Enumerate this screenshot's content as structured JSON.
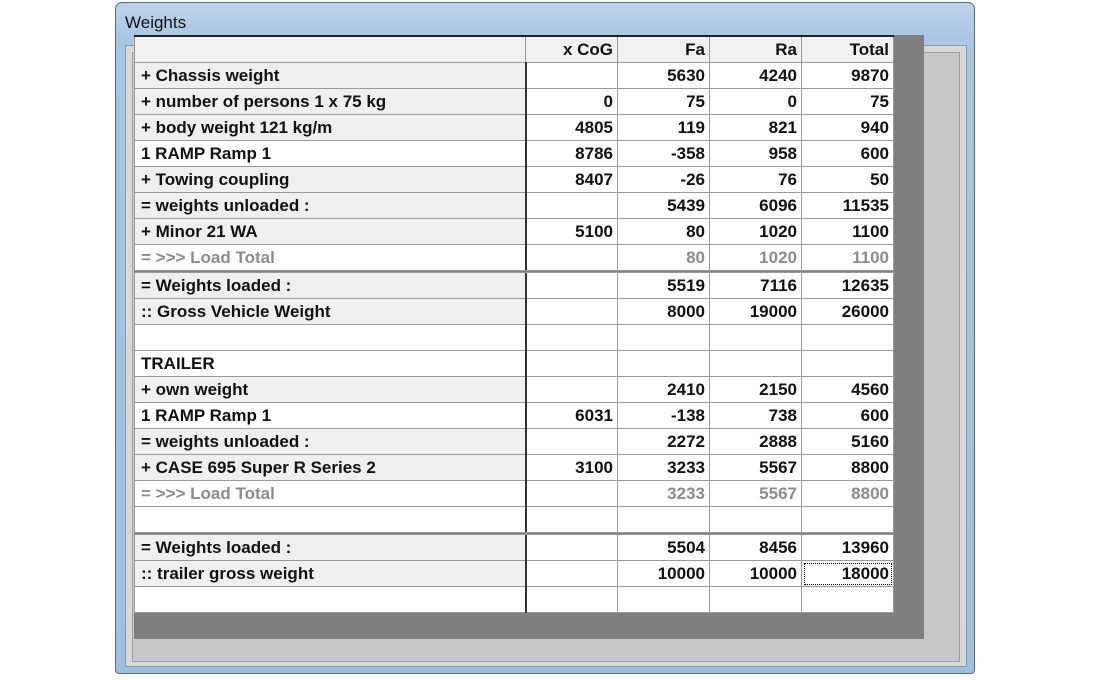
{
  "window": {
    "title": "Weights"
  },
  "columns": [
    "",
    "x CoG",
    "Fa",
    "Ra",
    "Total"
  ],
  "rows": [
    {
      "label": "+ Chassis weight",
      "cog": "",
      "fa": "5630",
      "ra": "4240",
      "total": "9870",
      "style": "shade"
    },
    {
      "label": "+ number of persons  1 x 75 kg",
      "cog": "0",
      "fa": "75",
      "ra": "0",
      "total": "75",
      "style": "shade"
    },
    {
      "label": "+ body weight  121 kg/m",
      "cog": "4805",
      "fa": "119",
      "ra": "821",
      "total": "940",
      "style": "shade"
    },
    {
      "label": "1 RAMP  Ramp 1",
      "cog": "8786",
      "fa": "-358",
      "ra": "958",
      "total": "600",
      "style": "plain"
    },
    {
      "label": "+ Towing coupling",
      "cog": "8407",
      "fa": "-26",
      "ra": "76",
      "total": "50",
      "style": "shade"
    },
    {
      "label": "= weights unloaded  :",
      "cog": "",
      "fa": "5439",
      "ra": "6096",
      "total": "11535",
      "style": "shade"
    },
    {
      "label": "+ Minor 21 WA",
      "cog": "5100",
      "fa": "80",
      "ra": "1020",
      "total": "1100",
      "style": "shade"
    },
    {
      "label": "= >>> Load Total",
      "cog": "",
      "fa": "80",
      "ra": "1020",
      "total": "1100",
      "style": "grey"
    },
    {
      "label": "= Weights loaded    :",
      "cog": "",
      "fa": "5519",
      "ra": "7116",
      "total": "12635",
      "style": "dbl"
    },
    {
      "label": ":: Gross Vehicle Weight",
      "cog": "",
      "fa": "8000",
      "ra": "19000",
      "total": "26000",
      "style": "shade"
    },
    {
      "label": "",
      "cog": "",
      "fa": "",
      "ra": "",
      "total": "",
      "style": "plain"
    },
    {
      "label": "TRAILER",
      "cog": "",
      "fa": "",
      "ra": "",
      "total": "",
      "style": "plain"
    },
    {
      "label": "+ own weight",
      "cog": "",
      "fa": "2410",
      "ra": "2150",
      "total": "4560",
      "style": "shade"
    },
    {
      "label": "1 RAMP  Ramp 1",
      "cog": "6031",
      "fa": "-138",
      "ra": "738",
      "total": "600",
      "style": "plain"
    },
    {
      "label": "= weights unloaded  :",
      "cog": "",
      "fa": "2272",
      "ra": "2888",
      "total": "5160",
      "style": "shade"
    },
    {
      "label": "+ CASE  695 Super R Series 2",
      "cog": "3100",
      "fa": "3233",
      "ra": "5567",
      "total": "8800",
      "style": "shade"
    },
    {
      "label": "= >>> Load Total",
      "cog": "",
      "fa": "3233",
      "ra": "5567",
      "total": "8800",
      "style": "grey"
    },
    {
      "label": "",
      "cog": "",
      "fa": "",
      "ra": "",
      "total": "",
      "style": "plain"
    },
    {
      "label": "= Weights loaded    :",
      "cog": "",
      "fa": "5504",
      "ra": "8456",
      "total": "13960",
      "style": "dbl"
    },
    {
      "label": ":: trailer gross weight",
      "cog": "",
      "fa": "10000",
      "ra": "10000",
      "total": "18000",
      "style": "shade"
    },
    {
      "label": "",
      "cog": "",
      "fa": "",
      "ra": "",
      "total": "",
      "style": "plain"
    }
  ]
}
